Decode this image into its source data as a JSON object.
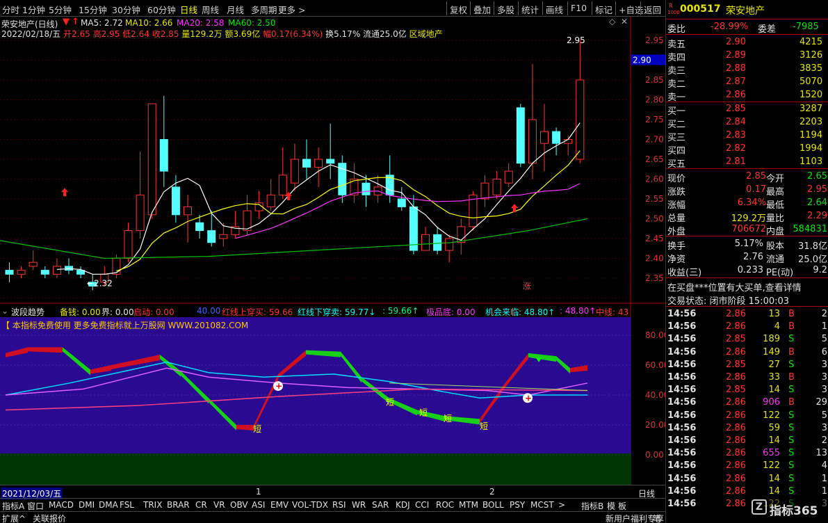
{
  "toolbar": {
    "left": [
      "分时",
      "1分钟",
      "5分钟",
      "15分钟",
      "30分钟",
      "60分钟",
      "日线",
      "周线",
      "月线",
      "多周期",
      "更多 >"
    ],
    "right": [
      "复权",
      "叠加",
      "多股",
      "统计",
      "画线",
      "F10",
      "标记",
      "+自选",
      "返回"
    ]
  },
  "chart": {
    "title": "荣安地产(日线)",
    "ma": {
      "ma5": "MA5: 2.72",
      "ma10": "MA10: 2.66",
      "ma20": "MA20: 2.58",
      "ma60": "MA60: 2.50"
    },
    "info": {
      "date": "2022/02/18/五",
      "open": "开2.65",
      "high": "高2.95",
      "low": "低2.64",
      "close": "收2.85",
      "vol": "量129.2万",
      "amt": "额3.69亿",
      "amp": "幅0.17(6.34%)",
      "turn": "换5.17%",
      "float": "流通25.0亿",
      "sector": "区域地产"
    },
    "y_ticks": [
      "2.95",
      "2.90",
      "2.85",
      "2.80",
      "2.75",
      "2.70",
      "2.65",
      "2.60",
      "2.55",
      "2.50",
      "2.45",
      "2.40",
      "2.35"
    ],
    "price_tag": "2.90",
    "high_label": "2.95",
    "low_label": "←2.32",
    "zhang": "涨"
  },
  "chart_data": {
    "type": "candlestick",
    "ylim": [
      2.32,
      2.97
    ],
    "candles": [
      [
        2.37,
        2.36,
        2.39,
        2.34
      ],
      [
        2.36,
        2.37,
        2.38,
        2.35
      ],
      [
        2.38,
        2.39,
        2.42,
        2.37
      ],
      [
        2.37,
        2.36,
        2.38,
        2.35
      ],
      [
        2.36,
        2.38,
        2.4,
        2.35
      ],
      [
        2.38,
        2.37,
        2.4,
        2.36
      ],
      [
        2.37,
        2.36,
        2.38,
        2.35
      ],
      [
        2.34,
        2.33,
        2.36,
        2.32
      ],
      [
        2.34,
        2.36,
        2.38,
        2.33
      ],
      [
        2.36,
        2.4,
        2.41,
        2.35
      ],
      [
        2.4,
        2.47,
        2.49,
        2.39
      ],
      [
        2.47,
        2.56,
        2.67,
        2.45
      ],
      [
        2.51,
        2.79,
        2.79,
        2.5
      ],
      [
        2.7,
        2.62,
        2.81,
        2.58
      ],
      [
        2.58,
        2.51,
        2.61,
        2.49
      ],
      [
        2.51,
        2.53,
        2.56,
        2.44
      ],
      [
        2.49,
        2.47,
        2.51,
        2.45
      ],
      [
        2.47,
        2.44,
        2.52,
        2.43
      ],
      [
        2.45,
        2.46,
        2.49,
        2.43
      ],
      [
        2.46,
        2.48,
        2.52,
        2.45
      ],
      [
        2.47,
        2.52,
        2.56,
        2.46
      ],
      [
        2.52,
        2.54,
        2.57,
        2.5
      ],
      [
        2.53,
        2.56,
        2.6,
        2.52
      ],
      [
        2.56,
        2.61,
        2.68,
        2.55
      ],
      [
        2.59,
        2.65,
        2.69,
        2.57
      ],
      [
        2.65,
        2.63,
        2.7,
        2.6
      ],
      [
        2.63,
        2.65,
        2.68,
        2.58
      ],
      [
        2.65,
        2.64,
        2.74,
        2.6
      ],
      [
        2.64,
        2.56,
        2.66,
        2.54
      ],
      [
        2.56,
        2.6,
        2.64,
        2.54
      ],
      [
        2.59,
        2.56,
        2.61,
        2.53
      ],
      [
        2.56,
        2.58,
        2.61,
        2.54
      ],
      [
        2.61,
        2.56,
        2.66,
        2.54
      ],
      [
        2.55,
        2.53,
        2.58,
        2.52
      ],
      [
        2.53,
        2.42,
        2.56,
        2.41
      ],
      [
        2.42,
        2.46,
        2.48,
        2.42
      ],
      [
        2.46,
        2.42,
        2.48,
        2.41
      ],
      [
        2.42,
        2.45,
        2.46,
        2.39
      ],
      [
        2.44,
        2.48,
        2.5,
        2.41
      ],
      [
        2.48,
        2.56,
        2.57,
        2.47
      ],
      [
        2.55,
        2.59,
        2.61,
        2.53
      ],
      [
        2.56,
        2.6,
        2.62,
        2.55
      ],
      [
        2.59,
        2.62,
        2.64,
        2.58
      ],
      [
        2.78,
        2.64,
        2.79,
        2.63
      ],
      [
        2.64,
        2.75,
        2.89,
        2.6
      ],
      [
        2.69,
        2.72,
        2.79,
        2.62
      ],
      [
        2.72,
        2.69,
        2.73,
        2.66
      ],
      [
        2.69,
        2.7,
        2.71,
        2.66
      ],
      [
        2.65,
        2.85,
        2.95,
        2.64
      ]
    ]
  },
  "indicator": {
    "name": "波段趋势",
    "beiqian": "备钱: 0.00",
    "jie": "界: 0.00",
    "qidong": "启动: 0.00",
    "v40": "40.00",
    "red_up": "红线上穿买: 59.66",
    "red_down": "红线下穿卖: 59.77↓",
    "v5966": ": 59.66↑",
    "jipindi": "极品底: 0.00",
    "jihui": "机会来临: 48.80↑",
    "v4880": ": 48.80↑",
    "zhongxian": "中线: 43",
    "ad": "【 本指标免费使用 更多免费指标就上万股网 WWW.201082.COM",
    "y_ticks": [
      "80.00",
      "60.00",
      "40.00",
      "20.00",
      "0.00"
    ],
    "short": "短"
  },
  "xaxis": {
    "start": "2021/12/03/五",
    "m1": "1",
    "m2": "2",
    "period": "日线"
  },
  "bottom_tabs": [
    "指标A",
    "窗口",
    "MACD",
    "DMI",
    "DMA",
    "FSL",
    "TRIX",
    "BRAR",
    "CR",
    "VR",
    "OBV",
    "ASI",
    "EMV",
    "VOL-TDX",
    "RSI",
    "WR",
    "SAR",
    "KDJ",
    "CCI",
    "ROC",
    "MTM",
    "BOLL",
    "PSY",
    "MCST",
    ">",
    "指标B",
    "模",
    "板"
  ],
  "status": {
    "expand": "扩展^",
    "related": "关联报价",
    "promo": "新用户福利专享",
    "pen": "笔"
  },
  "quote": {
    "r_mark": "R",
    "r_num": "1000",
    "code": "000517",
    "name": "荣安地产",
    "wb_label": "委比",
    "wb": "-28.99%",
    "wc_label": "委差",
    "wc": "-7985",
    "sells": [
      {
        "l": "卖五",
        "p": "2.90",
        "v": "4215"
      },
      {
        "l": "卖四",
        "p": "2.89",
        "v": "3126"
      },
      {
        "l": "卖三",
        "p": "2.88",
        "v": "3835"
      },
      {
        "l": "卖二",
        "p": "2.87",
        "v": "5070"
      },
      {
        "l": "卖一",
        "p": "2.86",
        "v": "1520"
      }
    ],
    "buys": [
      {
        "l": "买一",
        "p": "2.85",
        "v": "3287"
      },
      {
        "l": "买二",
        "p": "2.84",
        "v": "2203"
      },
      {
        "l": "买三",
        "p": "2.83",
        "v": "1194"
      },
      {
        "l": "买四",
        "p": "2.82",
        "v": "1994"
      },
      {
        "l": "买五",
        "p": "2.81",
        "v": "1103"
      }
    ],
    "stats": [
      [
        "现价",
        "2.85",
        "今开",
        "2.65"
      ],
      [
        "涨跌",
        "0.17",
        "最高",
        "2.95"
      ],
      [
        "涨幅",
        "6.34%",
        "最低",
        "2.64"
      ],
      [
        "总量",
        "129.2万",
        "量比",
        "2.29"
      ],
      [
        "外盘",
        "706672",
        "内盘",
        "584831"
      ]
    ],
    "stats2": [
      [
        "换手",
        "5.17%",
        "股本",
        "31.8亿"
      ],
      [
        "净资",
        "2.76",
        "流通",
        "25.0亿"
      ],
      [
        "收益(三)",
        "0.233",
        "PE(动)",
        "9.2"
      ]
    ],
    "notice": "在买盘***位置有大买单,查看详情",
    "trade_state": "交易状态: 闭市阶段 15:00:03",
    "ticks": [
      [
        "14:56",
        "2.86",
        "13",
        "B",
        "2"
      ],
      [
        "14:56",
        "2.86",
        "4",
        "B",
        "1"
      ],
      [
        "14:56",
        "2.85",
        "189",
        "S",
        "5"
      ],
      [
        "14:56",
        "2.86",
        "149",
        "B",
        "6"
      ],
      [
        "14:56",
        "2.85",
        "27",
        "S",
        "3"
      ],
      [
        "14:56",
        "2.86",
        "33",
        "B",
        "3"
      ],
      [
        "14:56",
        "2.85",
        "14",
        "S",
        "3"
      ],
      [
        "14:56",
        "2.86",
        "906",
        "B",
        "29"
      ],
      [
        "14:56",
        "2.86",
        "122",
        "S",
        "5"
      ],
      [
        "14:56",
        "2.86",
        "59",
        "S",
        "3"
      ],
      [
        "14:56",
        "2.86",
        "14",
        "S",
        "2"
      ],
      [
        "14:56",
        "2.86",
        "655",
        "S",
        "13"
      ],
      [
        "14:56",
        "2.86",
        "122",
        "S",
        "4"
      ],
      [
        "14:56",
        "2.86",
        "14",
        "S",
        "1"
      ],
      [
        "14:56",
        "2.86",
        "14",
        "S",
        "1"
      ],
      [
        "14:56",
        "2.86",
        "122",
        "S",
        "3"
      ]
    ]
  },
  "watermark": "指标365"
}
